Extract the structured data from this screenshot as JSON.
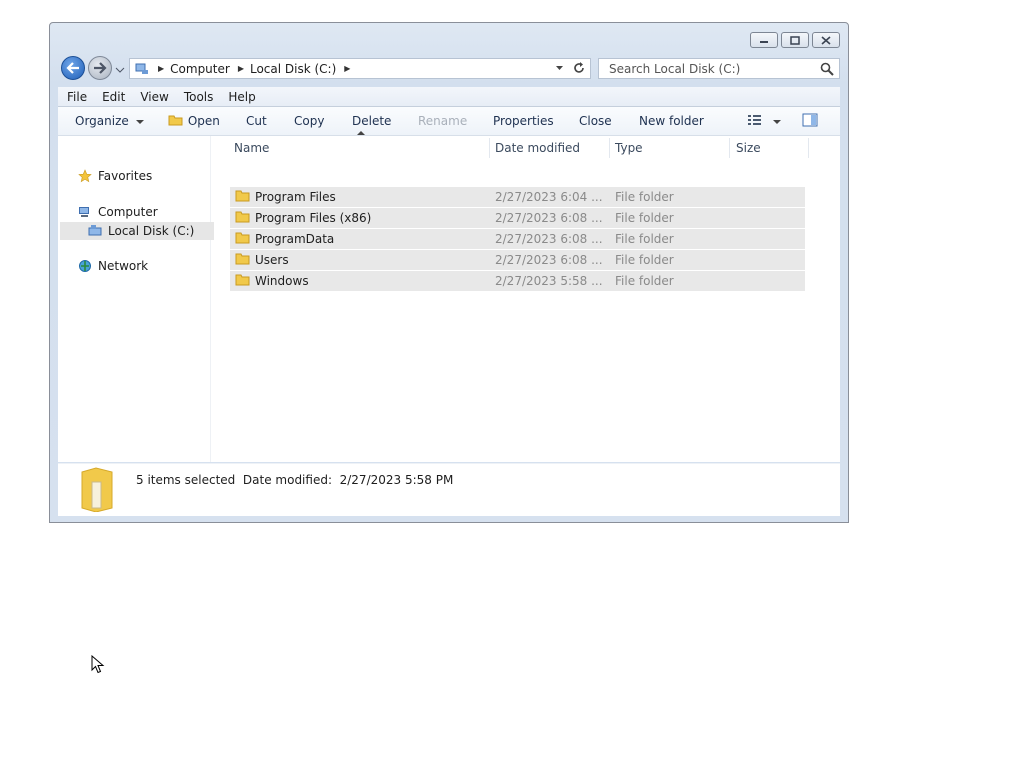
{
  "window": {
    "controls": {
      "minimize": "minimize-icon",
      "restore": "restore-icon",
      "close": "close-icon"
    }
  },
  "address": {
    "crumbs": [
      "Computer",
      "Local Disk (C:)"
    ]
  },
  "search": {
    "placeholder": "Search Local Disk (C:)"
  },
  "menu": [
    "File",
    "Edit",
    "View",
    "Tools",
    "Help"
  ],
  "toolbar": {
    "organize": "Organize",
    "open": "Open",
    "cut": "Cut",
    "copy": "Copy",
    "delete": "Delete",
    "rename": "Rename",
    "properties": "Properties",
    "close": "Close",
    "new_folder": "New folder"
  },
  "nav": {
    "favorites": "Favorites",
    "computer": "Computer",
    "local_disk": "Local Disk (C:)",
    "network": "Network"
  },
  "columns": {
    "name": "Name",
    "date": "Date modified",
    "type": "Type",
    "size": "Size"
  },
  "files": [
    {
      "name": "Program Files",
      "date": "2/27/2023 6:04 ...",
      "type": "File folder"
    },
    {
      "name": "Program Files (x86)",
      "date": "2/27/2023 6:08 ...",
      "type": "File folder"
    },
    {
      "name": "ProgramData",
      "date": "2/27/2023 6:08 ...",
      "type": "File folder"
    },
    {
      "name": "Users",
      "date": "2/27/2023 6:08 ...",
      "type": "File folder"
    },
    {
      "name": "Windows",
      "date": "2/27/2023 5:58 ...",
      "type": "File folder"
    }
  ],
  "details": {
    "text": "5 items selected  Date modified:  2/27/2023 5:58 PM"
  },
  "colors": {
    "accent": "#1f5fb8",
    "folder": "#f1c94a",
    "selection": "#e8e8e8"
  }
}
